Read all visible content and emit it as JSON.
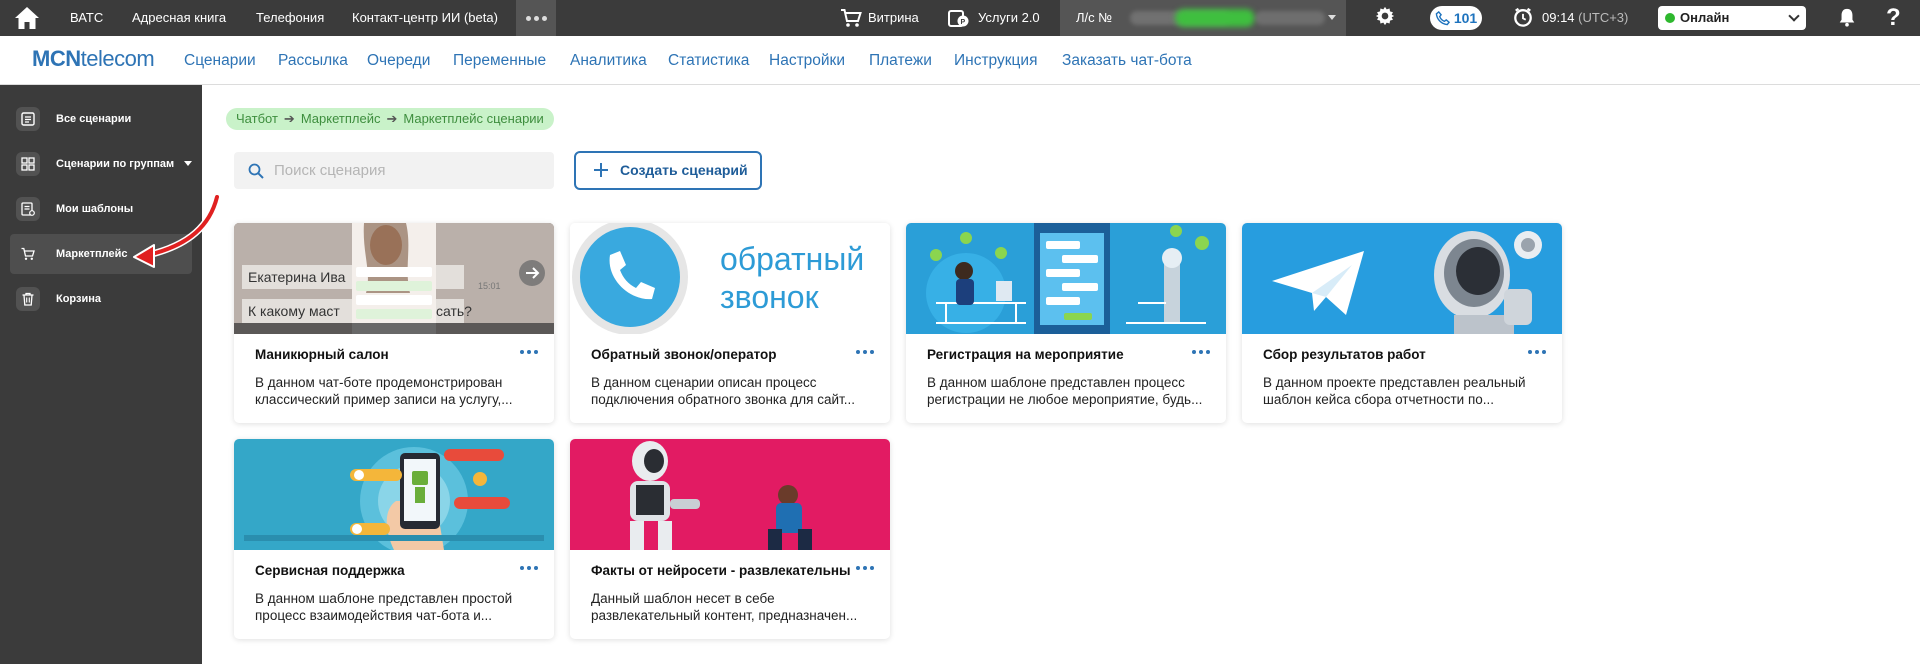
{
  "topbar": {
    "nav": [
      "ВАТС",
      "Адресная книга",
      "Телефония",
      "Контакт-центр ИИ (beta)"
    ],
    "showcase": "Витрина",
    "services": "Услуги 2.0",
    "account_label": "Л/с №",
    "calls_count": "101",
    "time": "09:14",
    "timezone": "(UTC+3)",
    "status": "Онлайн",
    "help": "?"
  },
  "brand": {
    "bold": "MCN",
    "light": "telecom"
  },
  "menu": [
    "Сценарии",
    "Рассылка",
    "Очереди",
    "Переменные",
    "Аналитика",
    "Статистика",
    "Настройки",
    "Платежи",
    "Инструкция",
    "Заказать чат-бота"
  ],
  "sidebar": {
    "items": [
      {
        "label": "Все сценарии",
        "icon": "list-icon"
      },
      {
        "label": "Сценарии по группам",
        "icon": "grid-icon"
      },
      {
        "label": "Мои шаблоны",
        "icon": "templates-icon"
      },
      {
        "label": "Маркетплейс",
        "icon": "cart-icon"
      },
      {
        "label": "Корзина",
        "icon": "trash-icon"
      }
    ],
    "active_index": 3
  },
  "breadcrumb": [
    "Чатбот",
    "Маркетплейс",
    "Маркетплейс сценарии"
  ],
  "search": {
    "placeholder": "Поиск сценария"
  },
  "create_button": "Создать сценарий",
  "cards": [
    {
      "title": "Маникюрный салон",
      "desc": [
        "В данном чат-боте продемонстрирован",
        "классический пример записи на услугу,..."
      ],
      "thumb_text": [
        "Екатерина Ива",
        "К какому маст",
        "сать?",
        "15:01"
      ]
    },
    {
      "title": "Обратный звонок/оператор",
      "desc": [
        "В данном сценарии описан процесс",
        "подключения обратного звонка для сайт..."
      ],
      "thumb_text": [
        "обратный",
        "звонок"
      ]
    },
    {
      "title": "Регистрация на мероприятие",
      "desc": [
        "В данном шаблоне представлен процесс",
        "регистрации не любое мероприятие, будь..."
      ]
    },
    {
      "title": "Сбор результатов работ",
      "desc": [
        "В данном проекте представлен реальный",
        "шаблон кейса сбора отчетности по..."
      ]
    },
    {
      "title": "Сервисная поддержка",
      "desc": [
        "В данном шаблоне представлен простой",
        "процесс взаимодействия чат-бота и..."
      ]
    },
    {
      "title": "Факты от нейросети - развлекательный",
      "desc": [
        "Данный шаблон несет в себе",
        "развлекательный контент, предназначен..."
      ]
    }
  ]
}
